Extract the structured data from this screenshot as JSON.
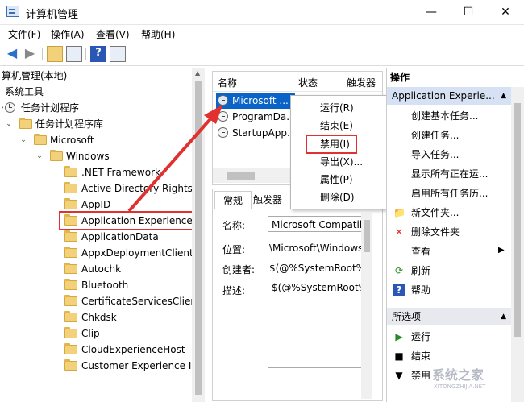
{
  "window": {
    "title": "计算机管理",
    "minimize": "—",
    "maximize": "☐",
    "close": "✕"
  },
  "menu": [
    "文件(F)",
    "操作(A)",
    "查看(V)",
    "帮助(H)"
  ],
  "toolbar": {
    "back_icon": "back-arrow-icon",
    "forward_icon": "forward-arrow-icon",
    "help_label": "?"
  },
  "tree": {
    "root": "算机管理(本地)",
    "system_tools": "系统工具",
    "task_scheduler": "任务计划程序",
    "task_library": "任务计划程序库",
    "microsoft": "Microsoft",
    "windows": "Windows",
    "folders": [
      ".NET Framework",
      "Active Directory Rights",
      "AppID",
      "Application Experience",
      "ApplicationData",
      "AppxDeploymentClient",
      "Autochk",
      "Bluetooth",
      "CertificateServicesClient",
      "Chkdsk",
      "Clip",
      "CloudExperienceHost",
      "Customer Experience Ir"
    ],
    "selected": "Application Experience"
  },
  "task_list": {
    "columns": [
      "名称",
      "状态",
      "触发器"
    ],
    "rows": [
      {
        "name": "Microsoft ...",
        "status": "",
        "trigger": ""
      },
      {
        "name": "ProgramDa...",
        "status": "",
        "trigger": ""
      },
      {
        "name": "StartupApp...",
        "status": "",
        "trigger": ""
      }
    ]
  },
  "detail": {
    "tabs": [
      "常规",
      "触发器"
    ],
    "labels": {
      "name": "名称:",
      "location": "位置:",
      "author": "创建者:",
      "description": "描述:"
    },
    "values": {
      "name": "Microsoft Compatibi",
      "location": "\\Microsoft\\Windows\\",
      "author": "$(@%SystemRoot%",
      "description": "$(@%SystemRoot%"
    }
  },
  "context_menu": [
    "运行(R)",
    "结束(E)",
    "禁用(I)",
    "导出(X)...",
    "属性(P)",
    "删除(D)"
  ],
  "context_menu_highlight": "禁用(I)",
  "actions": {
    "header": "操作",
    "section1": "Application Experie...",
    "items1": [
      "创建基本任务...",
      "创建任务...",
      "导入任务...",
      "显示所有正在运...",
      "启用所有任务历...",
      "新文件夹...",
      "删除文件夹",
      "查看",
      "刷新",
      "帮助"
    ],
    "section2": "所选项",
    "items2": [
      "运行",
      "结束",
      "禁用"
    ]
  },
  "colors": {
    "accent_red": "#e03030",
    "selection_blue": "#0a64c8",
    "action_header": "#e7e9ee"
  },
  "watermark": "系统之家 XITONGZHIJIA.NET"
}
